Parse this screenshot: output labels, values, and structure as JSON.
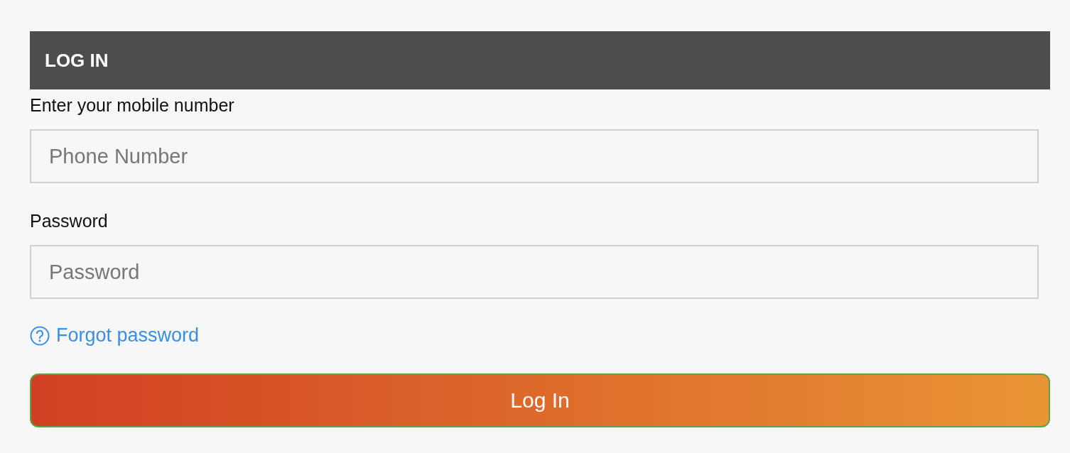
{
  "header": {
    "title": "LOG IN"
  },
  "fields": [
    {
      "label": "Enter your mobile number",
      "placeholder": "Phone Number"
    },
    {
      "label": "Password",
      "placeholder": "Password"
    }
  ],
  "forgot_link": "Forgot password",
  "submit_button": "Log In"
}
